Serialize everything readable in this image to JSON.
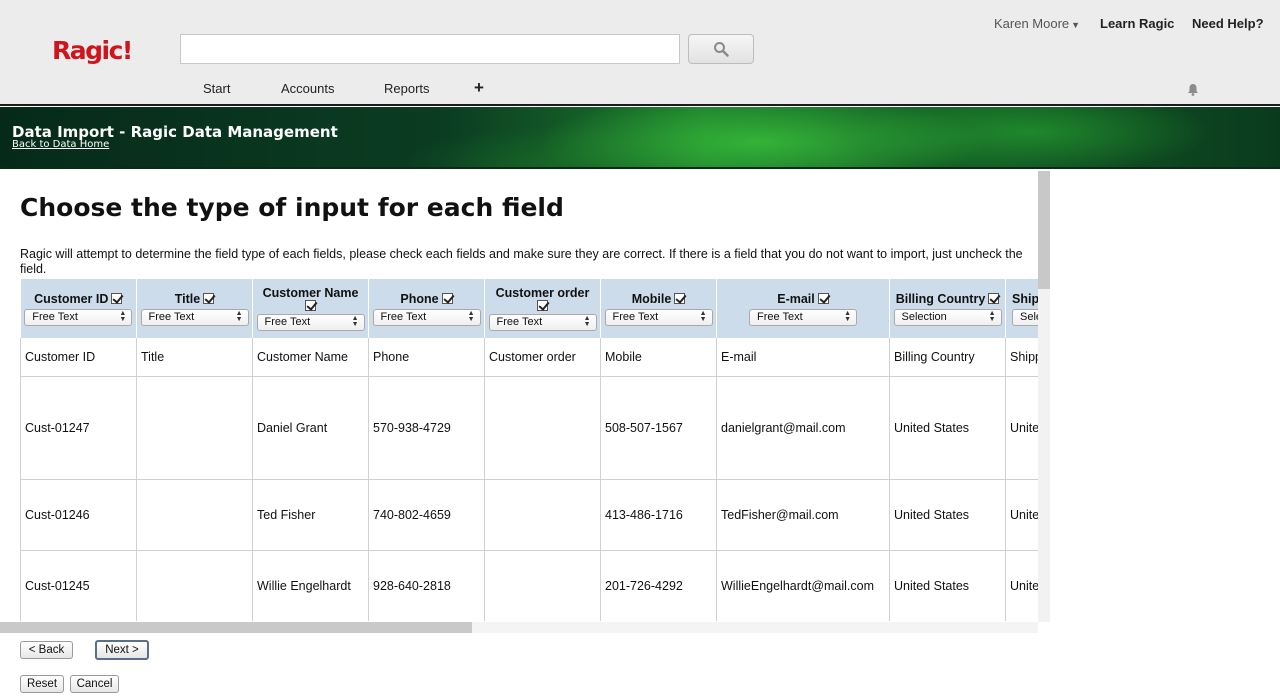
{
  "app": {
    "logo": "Ragic!"
  },
  "header": {
    "search": {
      "placeholder": "",
      "value": ""
    },
    "user_name": "Karen Moore",
    "learn_label": "Learn Ragic",
    "help_label": "Need Help?",
    "nav": [
      "Start",
      "Accounts",
      "Reports"
    ],
    "nav_add": "+"
  },
  "banner": {
    "title": "Data Import - Ragic Data Management",
    "back_link": "Back to Data Home"
  },
  "main": {
    "title": "Choose the type of input for each field",
    "instructions": "Ragic will attempt to determine the field type of each fields, please check each fields and make sure they are correct. If there is a field that you do not want to import, just uncheck the field."
  },
  "table": {
    "columns": [
      {
        "name": "Customer ID",
        "type": "Free Text",
        "checked": true
      },
      {
        "name": "Title",
        "type": "Free Text",
        "checked": true
      },
      {
        "name": "Customer Name",
        "type": "Free Text",
        "checked": true
      },
      {
        "name": "Phone",
        "type": "Free Text",
        "checked": true
      },
      {
        "name": "Customer order",
        "type": "Free Text",
        "checked": true
      },
      {
        "name": "Mobile",
        "type": "Free Text",
        "checked": true
      },
      {
        "name": "E-mail",
        "type": "Free Text",
        "checked": true
      },
      {
        "name": "Billing Country",
        "type": "Selection",
        "checked": true
      },
      {
        "name": "Shipping Country",
        "type": "Selection",
        "checked": true
      }
    ],
    "rows": [
      [
        "Customer ID",
        "Title",
        "Customer Name",
        "Phone",
        "Customer order",
        "Mobile",
        "E-mail",
        "Billing Country",
        "Shipping Country"
      ],
      [
        "Cust-01247",
        "",
        "Daniel Grant",
        "570-938-4729",
        "",
        "508-507-1567",
        "danielgrant@mail.com",
        "United States",
        "United States"
      ],
      [
        "Cust-01246",
        "",
        "Ted Fisher",
        "740-802-4659",
        "",
        "413-486-1716",
        "TedFisher@mail.com",
        "United States",
        "United States"
      ],
      [
        "Cust-01245",
        "",
        "Willie Engelhardt",
        "928-640-2818",
        "",
        "201-726-4292",
        "WillieEngelhardt@mail.com",
        "United States",
        "United States"
      ]
    ]
  },
  "buttons": {
    "back": "< Back",
    "next": "Next >",
    "reset": "Reset",
    "cancel": "Cancel"
  }
}
